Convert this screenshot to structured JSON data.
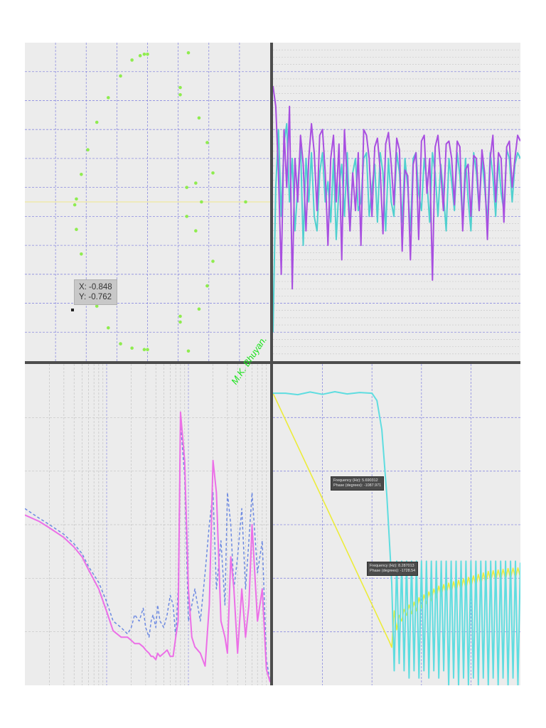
{
  "watermark": "M.K. Bhuyan.",
  "colors": {
    "scatter_points": "#8fec4f",
    "magnitude_purple": "#a84fe0",
    "magnitude_cyan": "#50d0cf",
    "spectrum_pink": "#ec6fe7",
    "spectrum_blue_dashed": "#6d8ae2",
    "phase_yellow": "#ecec3a",
    "response_cyan": "#5fdde0"
  },
  "tooltips": {
    "cursor_xy": {
      "x_line": "X: -0.848",
      "y_line": "Y: -0.762"
    },
    "phase_marker_1": {
      "line1": "Frequency (Hz): 5.690312",
      "line2": "Phase (degrees): -1087.971"
    },
    "phase_marker_2": {
      "line1": "Frequency (Hz): 8.287013",
      "line2": "Phase (degrees): -1728.54"
    }
  },
  "chart_data": [
    {
      "type": "scatter",
      "panel": "top-left",
      "title": "",
      "xlabel": "",
      "ylabel": "",
      "grid": true,
      "xlim": [
        -1.5,
        1.5
      ],
      "ylim": [
        -1.1,
        1.1
      ],
      "series": [
        {
          "x": [
            -0.09,
            -0.04,
            0.0,
            -0.19,
            -0.33,
            -0.48,
            -0.62,
            -0.73,
            -0.81,
            -0.87,
            -0.89,
            -0.87,
            -0.81,
            -0.73,
            -0.62,
            -0.48,
            -0.33,
            -0.19,
            -0.04,
            0.0,
            0.5,
            0.4,
            0.4,
            0.63,
            0.73,
            0.8,
            0.59,
            0.48,
            0.66,
            0.48,
            0.59,
            0.8,
            0.73,
            0.63,
            0.4,
            0.4,
            0.5,
            1.2
          ],
          "y": [
            1.01,
            1.02,
            1.02,
            0.98,
            0.87,
            0.72,
            0.55,
            0.36,
            0.19,
            0.02,
            -0.02,
            -0.19,
            -0.36,
            -0.55,
            -0.72,
            -0.87,
            -0.98,
            -1.01,
            -1.02,
            -1.02,
            1.03,
            0.79,
            0.74,
            0.58,
            0.41,
            0.2,
            0.13,
            0.1,
            0.0,
            -0.1,
            -0.2,
            -0.41,
            -0.58,
            -0.74,
            -0.79,
            -0.83,
            -1.03,
            0.0
          ]
        }
      ]
    },
    {
      "type": "line",
      "panel": "top-right",
      "title": "",
      "xlabel": "",
      "ylabel": "",
      "grid": true,
      "xlim": [
        0,
        45
      ],
      "ylim": [
        -100,
        10
      ],
      "series": [
        {
          "x": [
            0,
            0.5,
            1,
            1.5,
            2,
            2.5,
            3,
            3.5,
            4,
            4.5,
            5,
            5.5,
            6,
            6.5,
            7,
            7.5,
            8,
            8.5,
            9,
            9.5,
            10,
            10.5,
            11,
            11.5,
            12,
            12.5,
            13,
            13.5,
            14,
            14.5,
            15,
            15.5,
            16,
            16.5,
            17,
            17.5,
            18,
            18.5,
            19,
            19.5,
            20,
            20.5,
            21,
            21.5,
            22,
            22.5,
            23,
            23.5,
            24,
            24.5,
            25,
            25.5,
            26,
            26.5,
            27,
            27.5,
            28,
            28.5,
            29,
            29.5,
            30,
            30.5,
            31,
            31.5,
            32,
            32.5,
            33,
            33.5,
            34,
            34.5,
            35,
            35.5,
            36,
            36.5,
            37,
            37.5,
            38,
            38.5,
            39,
            39.5,
            40,
            40.5,
            41,
            41.5,
            42,
            42.5,
            43,
            43.5,
            44,
            44.5,
            45
          ],
          "y": [
            -5,
            -12,
            -35,
            -70,
            -20,
            -40,
            -12,
            -75,
            -30,
            -45,
            -22,
            -32,
            -55,
            -30,
            -18,
            -28,
            -48,
            -22,
            -20,
            -35,
            -60,
            -30,
            -22,
            -45,
            -25,
            -65,
            -20,
            -38,
            -55,
            -35,
            -48,
            -28,
            -60,
            -20,
            -22,
            -30,
            -50,
            -26,
            -23,
            -34,
            -56,
            -25,
            -21,
            -32,
            -46,
            -23,
            -27,
            -62,
            -34,
            -36,
            -65,
            -32,
            -28,
            -58,
            -24,
            -22,
            -42,
            -30,
            -72,
            -26,
            -22,
            -34,
            -48,
            -25,
            -24,
            -30,
            -46,
            -24,
            -26,
            -55,
            -34,
            -32,
            -50,
            -29,
            -30,
            -48,
            -27,
            -35,
            -58,
            -30,
            -22,
            -45,
            -28,
            -30,
            -52,
            -26,
            -24,
            -40,
            -30,
            -22,
            -24
          ]
        },
        {
          "x": [
            0,
            0.5,
            1,
            1.5,
            2,
            2.5,
            3,
            3.5,
            4,
            4.5,
            5,
            5.5,
            6,
            6.5,
            7,
            7.5,
            8,
            8.5,
            9,
            9.5,
            10,
            10.5,
            11,
            11.5,
            12,
            12.5,
            13,
            13.5,
            14,
            14.5,
            15,
            15.5,
            16,
            16.5,
            17,
            17.5,
            18,
            18.5,
            19,
            19.5,
            20,
            20.5,
            21,
            21.5,
            22,
            22.5,
            23,
            23.5,
            24,
            24.5,
            25,
            25.5,
            26,
            26.5,
            27,
            27.5,
            28,
            28.5,
            29,
            29.5,
            30,
            30.5,
            31,
            31.5,
            32,
            32.5,
            33,
            33.5,
            34,
            34.5,
            35,
            35.5,
            36,
            36.5,
            37,
            37.5,
            38,
            38.5,
            39,
            39.5,
            40,
            40.5,
            41,
            41.5,
            42,
            42.5,
            43,
            43.5,
            44,
            44.5,
            45
          ],
          "y": [
            -90,
            -40,
            -20,
            -50,
            -25,
            -18,
            -45,
            -30,
            -55,
            -40,
            -25,
            -60,
            -30,
            -45,
            -28,
            -50,
            -55,
            -35,
            -28,
            -45,
            -38,
            -52,
            -30,
            -58,
            -40,
            -32,
            -50,
            -28,
            -55,
            -35,
            -30,
            -48,
            -45,
            -30,
            -28,
            -50,
            -40,
            -32,
            -52,
            -28,
            -35,
            -55,
            -30,
            -45,
            -50,
            -28,
            -35,
            -52,
            -30,
            -40,
            -55,
            -30,
            -28,
            -42,
            -48,
            -30,
            -38,
            -52,
            -28,
            -35,
            -50,
            -32,
            -42,
            -55,
            -30,
            -38,
            -48,
            -28,
            -36,
            -52,
            -30,
            -44,
            -55,
            -28,
            -35,
            -48,
            -30,
            -40,
            -52,
            -28,
            -36,
            -50,
            -30,
            -42,
            -48,
            -27,
            -30,
            -45,
            -32,
            -28,
            -30
          ]
        }
      ]
    },
    {
      "type": "line",
      "panel": "bottom-left",
      "title": "",
      "xlabel": "",
      "ylabel": "",
      "grid": true,
      "xscale": "log",
      "xlim": [
        1,
        1000
      ],
      "ylim": [
        0,
        100
      ],
      "series": [
        {
          "x": [
            1,
            1.5,
            2,
            3,
            4,
            5,
            6,
            8,
            10,
            12,
            15,
            18,
            20,
            22,
            25,
            28,
            30,
            33,
            35,
            37,
            40,
            42,
            45,
            50,
            55,
            60,
            65,
            70,
            75,
            80,
            90,
            100,
            110,
            120,
            140,
            160,
            180,
            200,
            220,
            250,
            280,
            300,
            330,
            360,
            400,
            450,
            500,
            550,
            600,
            700,
            800,
            900,
            1000
          ],
          "y": [
            53,
            51,
            49,
            46,
            43,
            40,
            36,
            30,
            23,
            17,
            15,
            15,
            14,
            13,
            13,
            12,
            11,
            10,
            9,
            9,
            8,
            10,
            9,
            10,
            11,
            9,
            9,
            15,
            20,
            85,
            70,
            30,
            15,
            12,
            10,
            6,
            25,
            70,
            60,
            20,
            15,
            10,
            40,
            30,
            10,
            30,
            15,
            25,
            50,
            20,
            30,
            5,
            1
          ]
        },
        {
          "x": [
            1,
            1.5,
            2,
            3,
            4,
            5,
            6,
            8,
            10,
            12,
            15,
            18,
            20,
            22,
            25,
            28,
            30,
            33,
            35,
            37,
            40,
            42,
            45,
            50,
            55,
            60,
            65,
            70,
            75,
            80,
            90,
            100,
            110,
            120,
            140,
            160,
            180,
            200,
            220,
            250,
            280,
            300,
            330,
            360,
            400,
            450,
            500,
            550,
            600,
            700,
            800,
            900,
            1000
          ],
          "y": [
            55,
            52,
            50,
            47,
            44,
            41,
            37,
            32,
            26,
            20,
            18,
            16,
            18,
            22,
            20,
            24,
            18,
            15,
            20,
            22,
            18,
            25,
            20,
            18,
            22,
            28,
            25,
            15,
            30,
            82,
            65,
            20,
            25,
            30,
            20,
            35,
            50,
            60,
            30,
            45,
            25,
            60,
            50,
            30,
            40,
            55,
            30,
            45,
            60,
            35,
            45,
            8,
            1
          ]
        }
      ]
    },
    {
      "type": "line",
      "panel": "bottom-right",
      "title": "",
      "xlabel": "",
      "ylabel": "",
      "grid": true,
      "xlim": [
        0,
        10
      ],
      "ylim": [
        -2000,
        200
      ],
      "series": [
        {
          "x": [
            0,
            4.7,
            4.8,
            4.9,
            5.0,
            5.1,
            5.2,
            5.3,
            5.4,
            5.5,
            5.6,
            5.7,
            5.8,
            5.9,
            6.0,
            6.1,
            6.2,
            6.3,
            6.4,
            6.5,
            6.6,
            6.7,
            6.8,
            6.9,
            7.0,
            7.1,
            7.2,
            7.3,
            7.4,
            7.5,
            7.6,
            7.7,
            7.8,
            7.9,
            8.0,
            8.1,
            8.2,
            8.3,
            8.4,
            8.5,
            8.6,
            8.7,
            8.8,
            8.9,
            9.0,
            9.1,
            9.2,
            9.3,
            9.4,
            9.5,
            9.6,
            9.7,
            9.8,
            9.9,
            10
          ],
          "y": [
            0,
            -1700,
            -1740,
            -1490,
            -1620,
            -1520,
            -1560,
            -1480,
            -1520,
            -1450,
            -1510,
            -1430,
            -1490,
            -1400,
            -1470,
            -1380,
            -1440,
            -1360,
            -1420,
            -1340,
            -1400,
            -1320,
            -1390,
            -1310,
            -1380,
            -1300,
            -1370,
            -1290,
            -1360,
            -1280,
            -1350,
            -1270,
            -1340,
            -1260,
            -1330,
            -1250,
            -1320,
            -1240,
            -1310,
            -1230,
            -1300,
            -1220,
            -1290,
            -1215,
            -1285,
            -1210,
            -1280,
            -1205,
            -1275,
            -1200,
            -1270,
            -1198,
            -1265,
            -1196,
            -1260
          ]
        },
        {
          "x": [
            0,
            0.5,
            1,
            1.5,
            2,
            2.5,
            3,
            3.5,
            4,
            4.2,
            4.4,
            4.6,
            4.7,
            4.8,
            4.9,
            5.0,
            5.1,
            5.2,
            5.3,
            5.4,
            5.5,
            5.6,
            5.7,
            5.8,
            5.9,
            6.0,
            6.1,
            6.2,
            6.3,
            6.4,
            6.5,
            6.6,
            6.7,
            6.8,
            6.9,
            7.0,
            7.1,
            7.2,
            7.3,
            7.4,
            7.5,
            7.6,
            7.7,
            7.8,
            7.9,
            8.0,
            8.1,
            8.2,
            8.3,
            8.4,
            8.5,
            8.6,
            8.7,
            8.8,
            8.9,
            9.0,
            9.1,
            9.2,
            9.3,
            9.4,
            9.5,
            9.6,
            9.7,
            9.8,
            9.9,
            10
          ],
          "y": [
            0,
            0,
            -10,
            8,
            -8,
            10,
            -5,
            5,
            0,
            -50,
            -250,
            -700,
            -1000,
            -1300,
            -1900,
            -1150,
            -1850,
            -1150,
            -1900,
            -1150,
            -1950,
            -1150,
            -1900,
            -1150,
            -1950,
            -1150,
            -1900,
            -1150,
            -1950,
            -1150,
            -1900,
            -1150,
            -1950,
            -1150,
            -1900,
            -1150,
            -2000,
            -1150,
            -1950,
            -1150,
            -2000,
            -1150,
            -1950,
            -1150,
            -2000,
            -1150,
            -1950,
            -1150,
            -2000,
            -1150,
            -1950,
            -1150,
            -2000,
            -1150,
            -1950,
            -1150,
            -2000,
            -1150,
            -1950,
            -1150,
            -2000,
            -1150,
            -1950,
            -1150,
            -2000,
            -1160
          ]
        }
      ]
    }
  ]
}
